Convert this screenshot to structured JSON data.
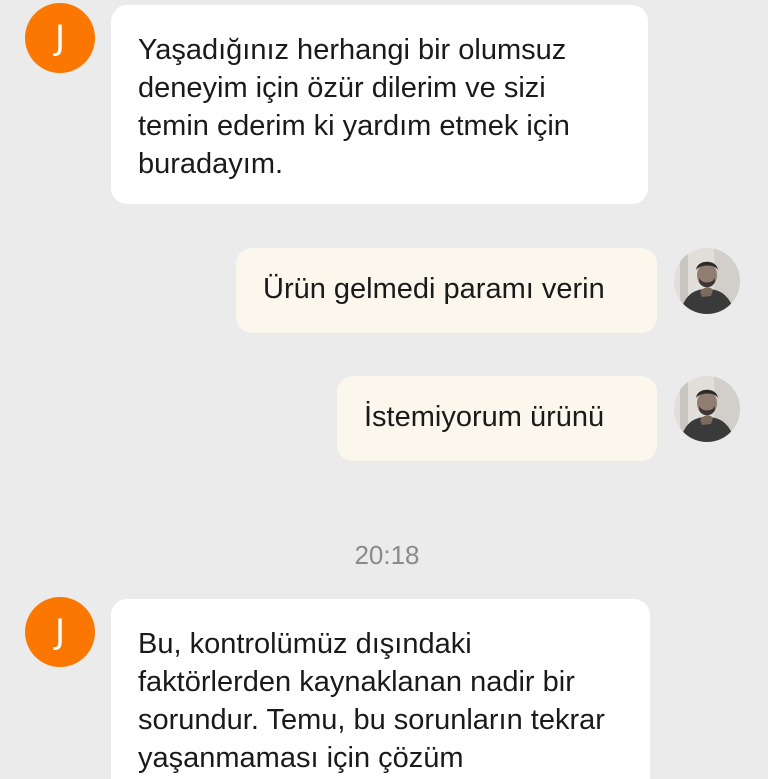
{
  "conversation": {
    "agent": {
      "avatar_letter": "J",
      "avatar_color": "#fb7701"
    },
    "messages": [
      {
        "sender": "agent",
        "text": "Yaşadığınız herhangi bir olumsuz deneyim için özür dilerim ve sizi temin ederim ki yardım etmek için buradayım."
      },
      {
        "sender": "user",
        "text": "Ürün gelmedi paramı verin"
      },
      {
        "sender": "user",
        "text": "İstemiyorum ürünü"
      },
      {
        "sender": "agent",
        "text": "Bu, kontrolümüz dışındaki faktörlerden kaynaklanan nadir bir sorundur. Temu, bu sorunların tekrar yaşanmaması için çözüm"
      }
    ],
    "timestamp": "20:18"
  },
  "colors": {
    "background": "#ebebeb",
    "agent_bubble": "#ffffff",
    "user_bubble": "#fbf7ec",
    "timestamp_text": "#8a8a8a"
  }
}
